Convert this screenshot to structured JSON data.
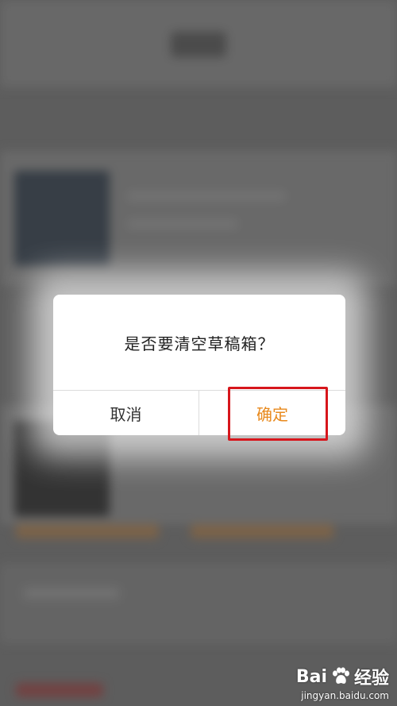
{
  "dialog": {
    "message": "是否要清空草稿箱？",
    "cancel_label": "取消",
    "confirm_label": "确定"
  },
  "watermark": {
    "brand_part1": "Bai",
    "brand_part2": "经验",
    "url": "jingyan.baidu.com"
  },
  "colors": {
    "confirm_text": "#e8891c",
    "highlight_border": "#d7161c"
  }
}
